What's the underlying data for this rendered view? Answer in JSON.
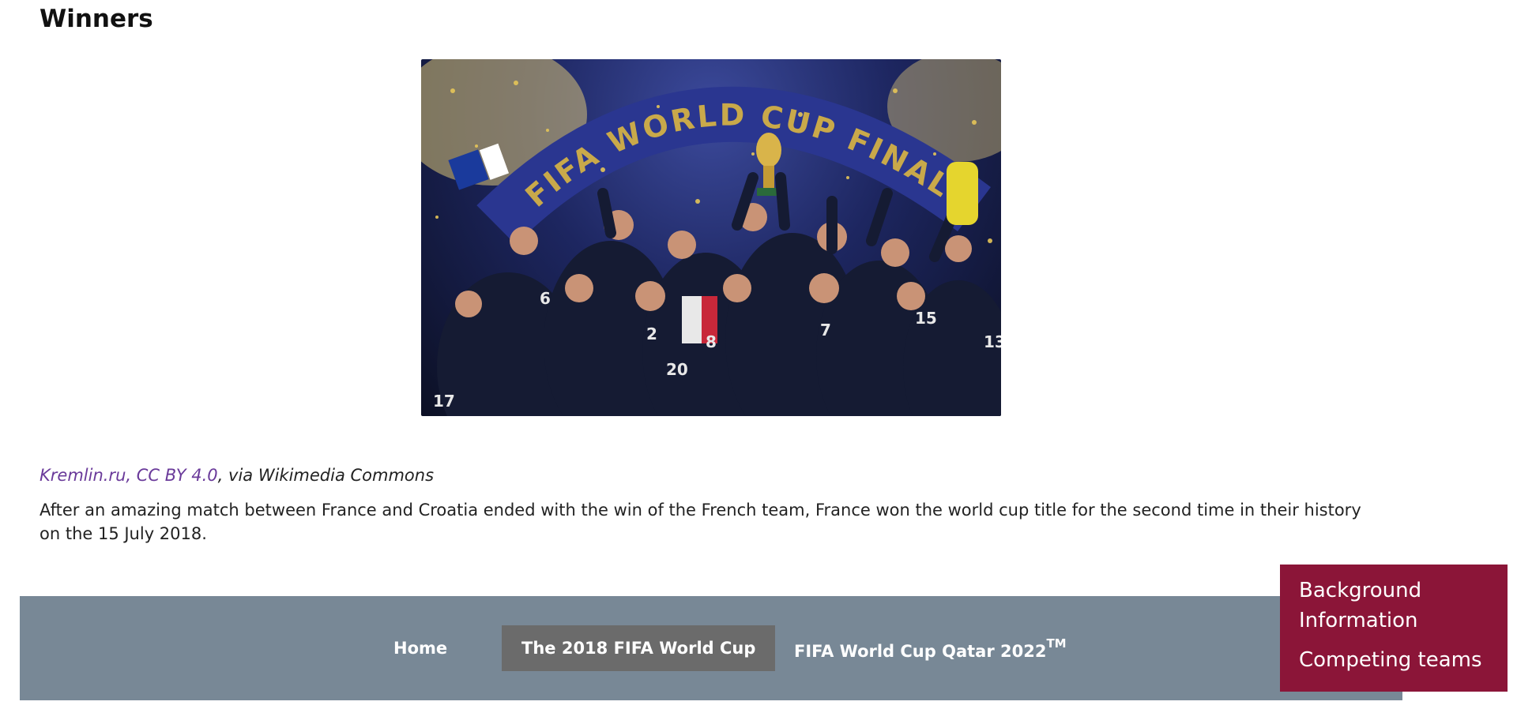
{
  "section": {
    "heading": "Winners"
  },
  "image": {
    "alt": "France team celebrating 2018 FIFA World Cup Final win",
    "banner_text": "FIFA WORLD CUP FINAL",
    "jersey_numbers": [
      "6",
      "2",
      "20",
      "8",
      "7",
      "15",
      "13",
      "17"
    ]
  },
  "credit": {
    "link_text": "Kremlin.ru, CC BY 4.0",
    "suffix": ", via Wikimedia Commons"
  },
  "body": {
    "paragraph": "After an amazing match between France and Croatia ended with the win of the French team, France won the world cup title for the second time in their history on the 15 July 2018."
  },
  "nav": {
    "home": "Home",
    "wc2018": "The 2018 FIFA World Cup",
    "wc2022": "FIFA World Cup Qatar 2022",
    "wc2022_sup": "TM"
  },
  "dropdown": {
    "items": [
      "Background Information",
      "Competing teams"
    ]
  },
  "colors": {
    "footer_bg": "#788896",
    "active_nav_bg": "#6b6b6b",
    "dropdown_bg": "#8b1538",
    "link": "#6a3a9a"
  }
}
